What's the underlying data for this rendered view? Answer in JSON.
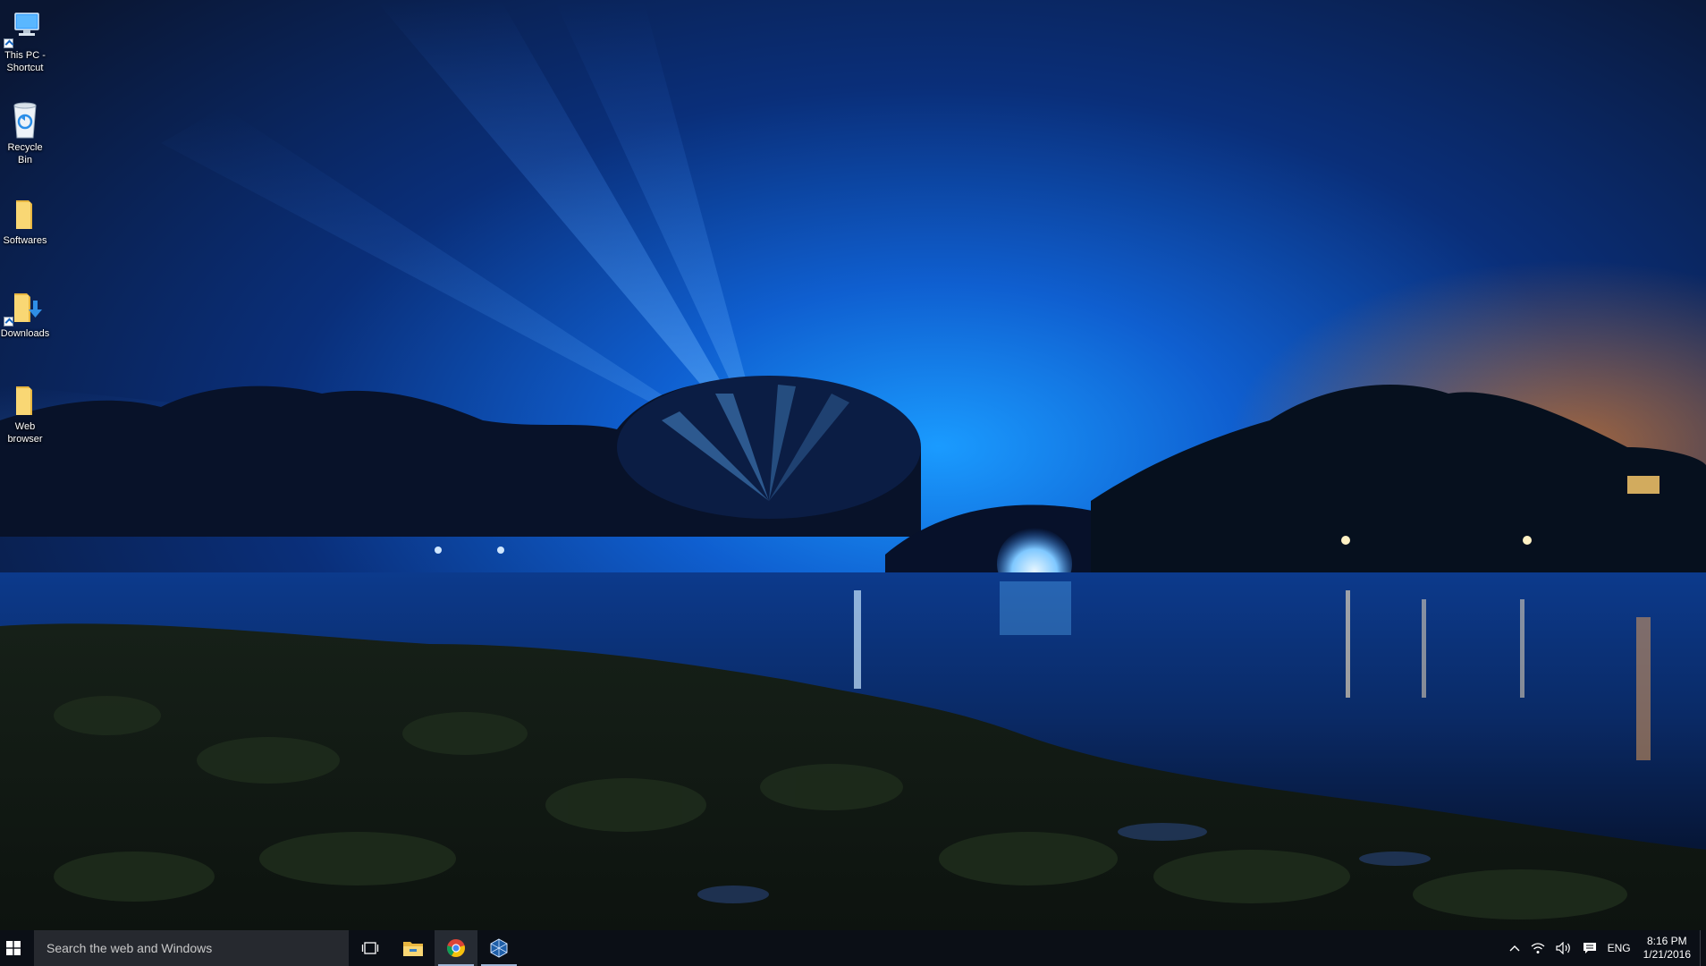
{
  "desktop": {
    "icons": [
      {
        "label": "This PC - Shortcut",
        "icon": "computer-icon"
      },
      {
        "label": "Recycle Bin",
        "icon": "recycle-bin-icon"
      },
      {
        "label": "Softwares",
        "icon": "folder-icon"
      },
      {
        "label": "Downloads",
        "icon": "downloads-folder-icon"
      },
      {
        "label": "Web browser",
        "icon": "folder-icon"
      }
    ]
  },
  "taskbar": {
    "search_placeholder": "Search the web and Windows",
    "pinned": [
      {
        "name": "task-view",
        "icon": "task-view-icon"
      },
      {
        "name": "file-explorer",
        "icon": "folder-icon"
      },
      {
        "name": "chrome",
        "icon": "chrome-icon",
        "active": true
      },
      {
        "name": "virtualbox",
        "icon": "virtualbox-icon",
        "running": true
      }
    ],
    "tray": {
      "language": "ENG",
      "time": "8:16 PM",
      "date": "1/21/2016"
    }
  },
  "colors": {
    "taskbar_bg": "#0b0f16",
    "search_bg": "#26292f",
    "sky_glow": "#1f8bff"
  }
}
